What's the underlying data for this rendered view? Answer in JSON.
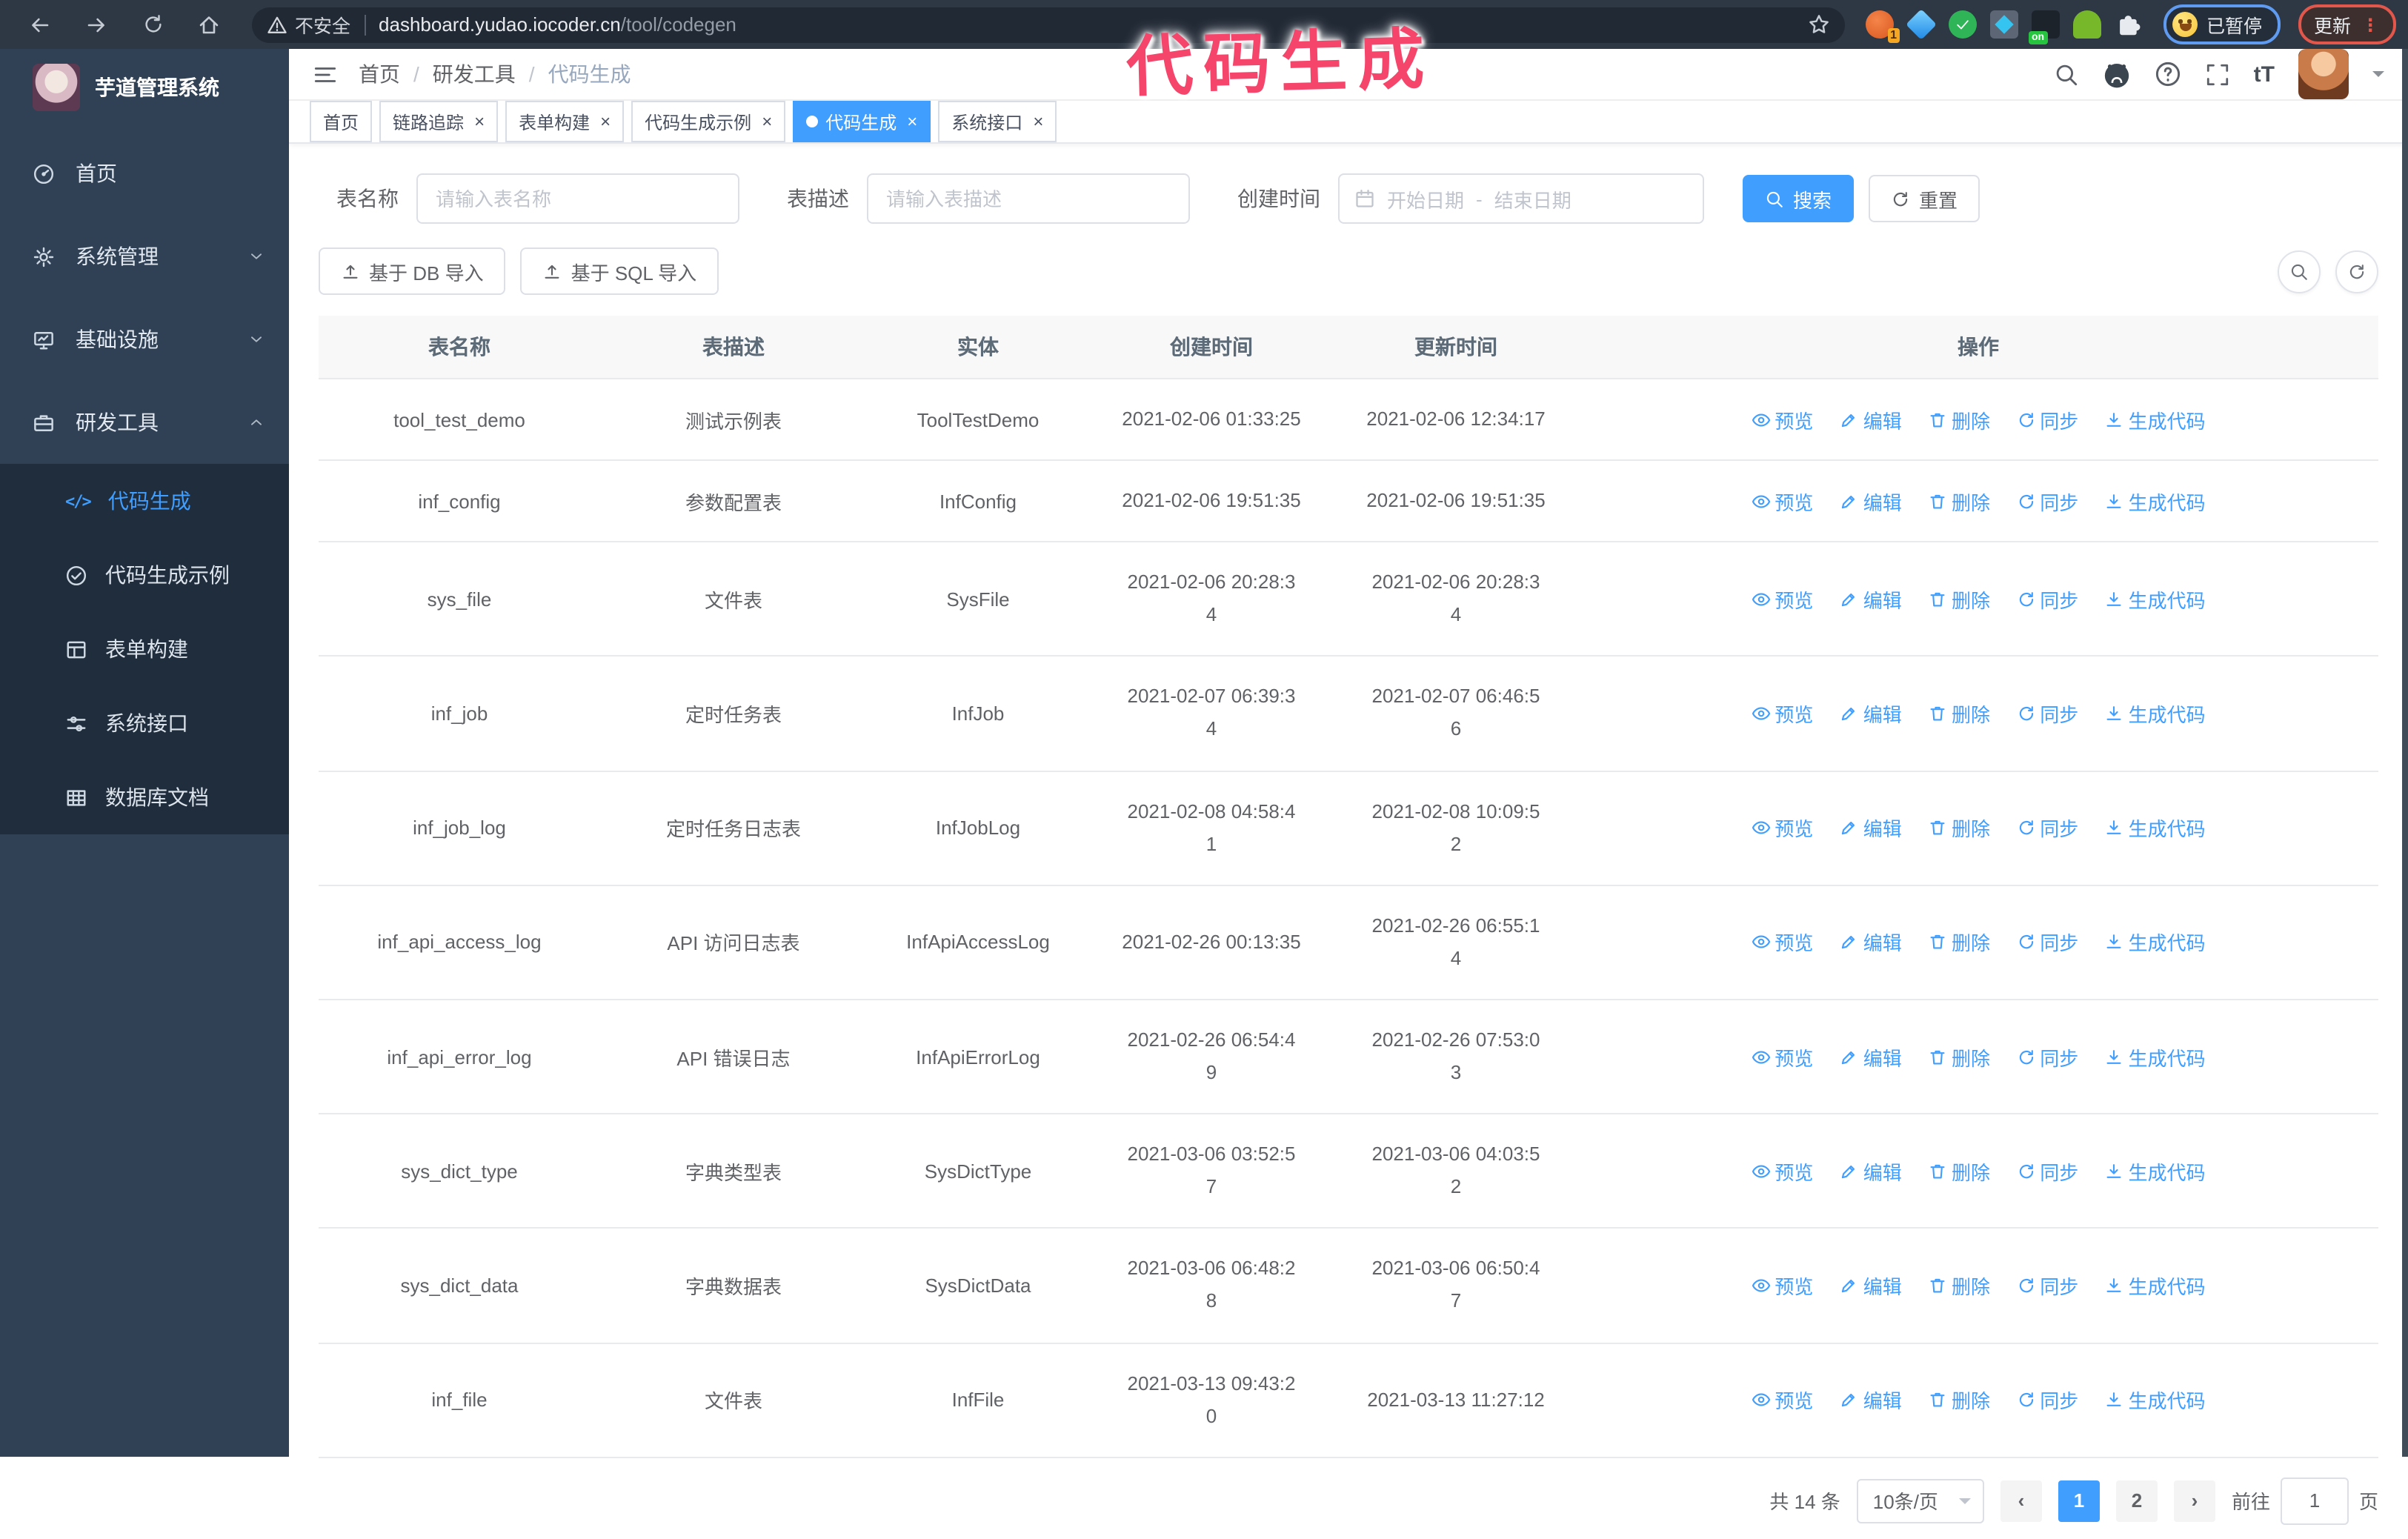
{
  "browser": {
    "security_label": "不安全",
    "url_host": "dashboard.yudao.iocoder.cn",
    "url_path": "/tool/codegen",
    "extension_badge": "1",
    "extension_on_badge": "on",
    "paused_badge": "已暂停",
    "update_button": "更新"
  },
  "annotation": {
    "text": "代码生成",
    "color": "#f5456b"
  },
  "sidebar": {
    "logo_title": "芋道管理系统",
    "items": [
      {
        "label": "首页",
        "icon": "dashboard-icon",
        "expandable": false
      },
      {
        "label": "系统管理",
        "icon": "gear-icon",
        "expandable": true
      },
      {
        "label": "基础设施",
        "icon": "monitor-icon",
        "expandable": true
      },
      {
        "label": "研发工具",
        "icon": "toolbox-icon",
        "expandable": true,
        "expanded": true
      }
    ],
    "submenu": [
      {
        "label": "代码生成",
        "icon": "code-icon",
        "active": true
      },
      {
        "label": "代码生成示例",
        "icon": "check-circle-icon",
        "active": false
      },
      {
        "label": "表单构建",
        "icon": "form-icon",
        "active": false
      },
      {
        "label": "系统接口",
        "icon": "sliders-icon",
        "active": false
      },
      {
        "label": "数据库文档",
        "icon": "database-doc-icon",
        "active": false
      }
    ]
  },
  "header": {
    "breadcrumb": [
      "首页",
      "研发工具",
      "代码生成"
    ],
    "right_icons": [
      "search-icon",
      "github-icon",
      "help-icon",
      "fullscreen-icon",
      "text-size-icon",
      "avatar",
      "caret-down-icon"
    ]
  },
  "tabs": [
    {
      "label": "首页",
      "closable": false,
      "active": false
    },
    {
      "label": "链路追踪",
      "closable": true,
      "active": false
    },
    {
      "label": "表单构建",
      "closable": true,
      "active": false
    },
    {
      "label": "代码生成示例",
      "closable": true,
      "active": false
    },
    {
      "label": "代码生成",
      "closable": true,
      "active": true
    },
    {
      "label": "系统接口",
      "closable": true,
      "active": false
    }
  ],
  "filters": {
    "table_name_label": "表名称",
    "table_name_placeholder": "请输入表名称",
    "table_desc_label": "表描述",
    "table_desc_placeholder": "请输入表描述",
    "create_time_label": "创建时间",
    "date_start_placeholder": "开始日期",
    "date_separator": "-",
    "date_end_placeholder": "结束日期",
    "search_button": "搜索",
    "reset_button": "重置"
  },
  "toolbar": {
    "import_db_button": "基于 DB 导入",
    "import_sql_button": "基于 SQL 导入"
  },
  "table": {
    "columns": [
      "表名称",
      "表描述",
      "实体",
      "创建时间",
      "更新时间",
      "操作"
    ],
    "actions": [
      "预览",
      "编辑",
      "删除",
      "同步",
      "生成代码"
    ],
    "rows": [
      {
        "name": "tool_test_demo",
        "desc": "测试示例表",
        "entity": "ToolTestDemo",
        "created": "2021-02-06 01:33:25",
        "updated": "2021-02-06 12:34:17"
      },
      {
        "name": "inf_config",
        "desc": "参数配置表",
        "entity": "InfConfig",
        "created": "2021-02-06 19:51:35",
        "updated": "2021-02-06 19:51:35"
      },
      {
        "name": "sys_file",
        "desc": "文件表",
        "entity": "SysFile",
        "created": "2021-02-06 20:28:3\n4",
        "updated": "2021-02-06 20:28:3\n4"
      },
      {
        "name": "inf_job",
        "desc": "定时任务表",
        "entity": "InfJob",
        "created": "2021-02-07 06:39:3\n4",
        "updated": "2021-02-07 06:46:5\n6"
      },
      {
        "name": "inf_job_log",
        "desc": "定时任务日志表",
        "entity": "InfJobLog",
        "created": "2021-02-08 04:58:4\n1",
        "updated": "2021-02-08 10:09:5\n2"
      },
      {
        "name": "inf_api_access_log",
        "desc": "API 访问日志表",
        "entity": "InfApiAccessLog",
        "created": "2021-02-26 00:13:35",
        "updated": "2021-02-26 06:55:1\n4"
      },
      {
        "name": "inf_api_error_log",
        "desc": "API 错误日志",
        "entity": "InfApiErrorLog",
        "created": "2021-02-26 06:54:4\n9",
        "updated": "2021-02-26 07:53:0\n3"
      },
      {
        "name": "sys_dict_type",
        "desc": "字典类型表",
        "entity": "SysDictType",
        "created": "2021-03-06 03:52:5\n7",
        "updated": "2021-03-06 04:03:5\n2"
      },
      {
        "name": "sys_dict_data",
        "desc": "字典数据表",
        "entity": "SysDictData",
        "created": "2021-03-06 06:48:2\n8",
        "updated": "2021-03-06 06:50:4\n7"
      },
      {
        "name": "inf_file",
        "desc": "文件表",
        "entity": "InfFile",
        "created": "2021-03-13 09:43:2\n0",
        "updated": "2021-03-13 11:27:12"
      }
    ]
  },
  "pagination": {
    "total": "共 14 条",
    "page_size": "10条/页",
    "pages": [
      "1",
      "2"
    ],
    "active_page": "1",
    "goto_label": "前往",
    "goto_value": "1",
    "page_suffix": "页"
  },
  "glyphs": {
    "close": "×",
    "prev": "‹",
    "next": "›",
    "more_vertical": "⋮",
    "text_size": "tT",
    "code": "</>",
    "question": "?"
  },
  "colors": {
    "primary": "#409eff",
    "sidebar_bg": "#304156",
    "submenu_bg": "#1f2d3d",
    "annotation": "#f5456b",
    "chrome_bg": "#2e3744"
  }
}
